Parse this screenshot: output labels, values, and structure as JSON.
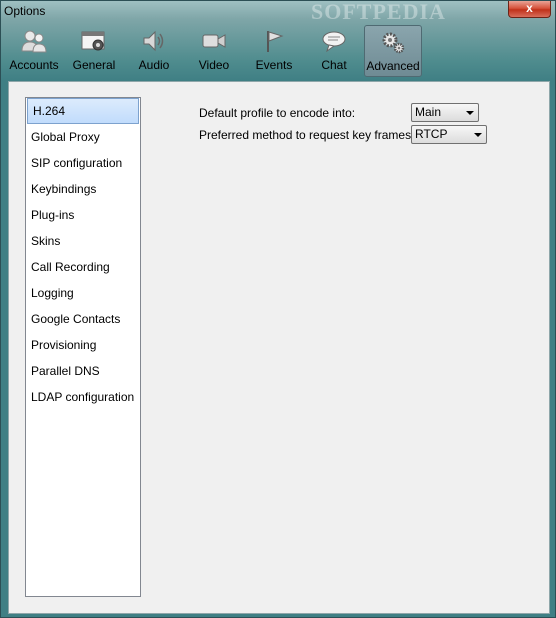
{
  "window": {
    "title": "Options",
    "watermark": "SOFTPEDIA",
    "close_label": "x"
  },
  "toolbar": {
    "items": [
      {
        "label": "Accounts",
        "icon": "accounts-icon"
      },
      {
        "label": "General",
        "icon": "general-icon"
      },
      {
        "label": "Audio",
        "icon": "audio-icon"
      },
      {
        "label": "Video",
        "icon": "video-icon"
      },
      {
        "label": "Events",
        "icon": "events-icon"
      },
      {
        "label": "Chat",
        "icon": "chat-icon"
      },
      {
        "label": "Advanced",
        "icon": "advanced-icon",
        "active": true
      }
    ]
  },
  "sidebar": {
    "selected": "H.264",
    "items": [
      {
        "label": "H.264"
      },
      {
        "label": "Global Proxy"
      },
      {
        "label": "SIP configuration"
      },
      {
        "label": "Keybindings"
      },
      {
        "label": "Plug-ins"
      },
      {
        "label": "Skins"
      },
      {
        "label": "Call Recording"
      },
      {
        "label": "Logging"
      },
      {
        "label": "Google Contacts"
      },
      {
        "label": "Provisioning"
      },
      {
        "label": "Parallel DNS"
      },
      {
        "label": "LDAP configuration"
      }
    ]
  },
  "settings": {
    "profile_label": "Default profile to encode into:",
    "profile_value": "Main",
    "keyframe_label": "Preferred method to request key frames:",
    "keyframe_value": "RTCP"
  }
}
